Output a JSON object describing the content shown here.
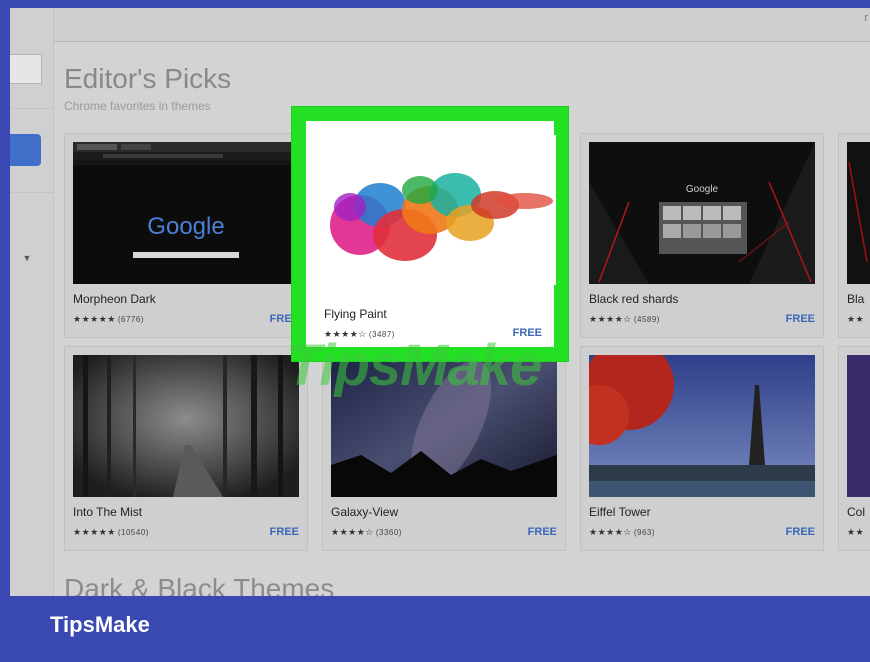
{
  "window": {
    "corner_mark": "r"
  },
  "section": {
    "title": "Editor's Picks",
    "subtitle": "Chrome favorites in themes"
  },
  "section2": {
    "title": "Dark & Black Themes"
  },
  "themes_row1": [
    {
      "name": "Morpheon Dark",
      "stars": "★★★★★",
      "count": "(6776)",
      "price": "FREE",
      "thumb_logo": "Google"
    },
    {
      "name": "Flying Paint",
      "stars": "★★★★☆",
      "count": "(3487)",
      "price": "FREE"
    },
    {
      "name": "Black red shards",
      "stars": "★★★★☆",
      "count": "(4589)",
      "price": "FREE",
      "thumb_logo": "Google"
    },
    {
      "name": "Bla",
      "stars": "★★",
      "count": "",
      "price": ""
    }
  ],
  "themes_row2": [
    {
      "name": "Into The Mist",
      "stars": "★★★★★",
      "count": "(10540)",
      "price": "FREE"
    },
    {
      "name": "Galaxy-View",
      "stars": "★★★★☆",
      "count": "(3360)",
      "price": "FREE"
    },
    {
      "name": "Eiffel Tower",
      "stars": "★★★★☆",
      "count": "(963)",
      "price": "FREE"
    },
    {
      "name": "Col",
      "stars": "★★",
      "count": "",
      "price": ""
    }
  ],
  "watermark": "TipsMake",
  "brand": "TipsMake",
  "colors": {
    "frame": "#3a48b2",
    "highlight": "#24e024",
    "free": "#3b67b8"
  }
}
